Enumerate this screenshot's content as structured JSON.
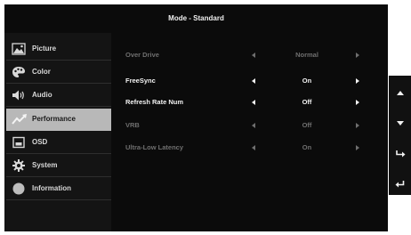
{
  "title": "Mode - Standard",
  "colors": {
    "panel_bg": "#0b0b0b",
    "sidebar_bg": "#141414",
    "active_item_bg": "#b8b8b8",
    "text_enabled": "#f2f2f2",
    "text_disabled": "#6f6f6f"
  },
  "menu": [
    {
      "label": "Picture",
      "icon": "picture-icon",
      "active": false
    },
    {
      "label": "Color",
      "icon": "palette-icon",
      "active": false
    },
    {
      "label": "Audio",
      "icon": "speaker-icon",
      "active": false
    },
    {
      "label": "Performance",
      "icon": "performance-graph-icon",
      "active": true
    },
    {
      "label": "OSD",
      "icon": "osd-window-icon",
      "active": false
    },
    {
      "label": "System",
      "icon": "gear-icon",
      "active": false
    },
    {
      "label": "Information",
      "icon": "info-circle-icon",
      "active": false
    }
  ],
  "settings": [
    {
      "name": "Over Drive",
      "value": "Normal",
      "enabled": false
    },
    {
      "name": "FreeSync",
      "value": "On",
      "enabled": true
    },
    {
      "name": "Refresh Rate Num",
      "value": "Off",
      "enabled": true
    },
    {
      "name": "VRB",
      "value": "Off",
      "enabled": false
    },
    {
      "name": "Ultra-Low Latency",
      "value": "On",
      "enabled": false
    }
  ],
  "nav_buttons": [
    "up-arrow-icon",
    "down-arrow-icon",
    "enter-icon",
    "back-icon"
  ]
}
